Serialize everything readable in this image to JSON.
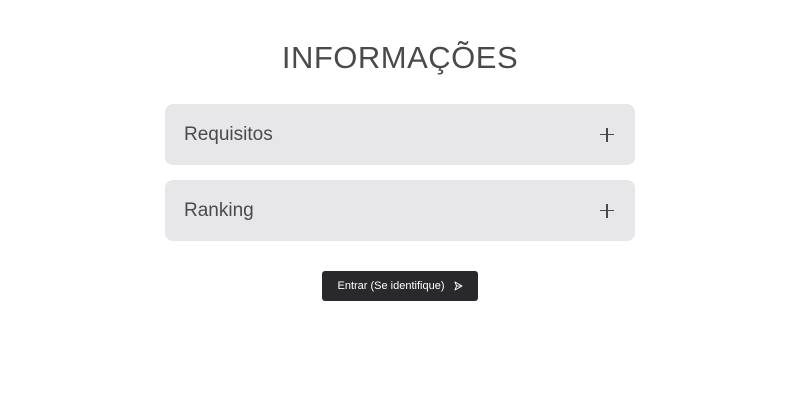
{
  "page": {
    "title": "INFORMAÇÕES"
  },
  "accordion": {
    "items": [
      {
        "label": "Requisitos",
        "icon": "plus-icon"
      },
      {
        "label": "Ranking",
        "icon": "plus-icon"
      }
    ]
  },
  "login": {
    "label": "Entrar (Se identifique)",
    "icon": "send-icon"
  },
  "colors": {
    "text": "#4a4a4d",
    "panel_bg": "#e7e7e9",
    "button_bg": "#29292b",
    "button_text": "#ffffff"
  }
}
